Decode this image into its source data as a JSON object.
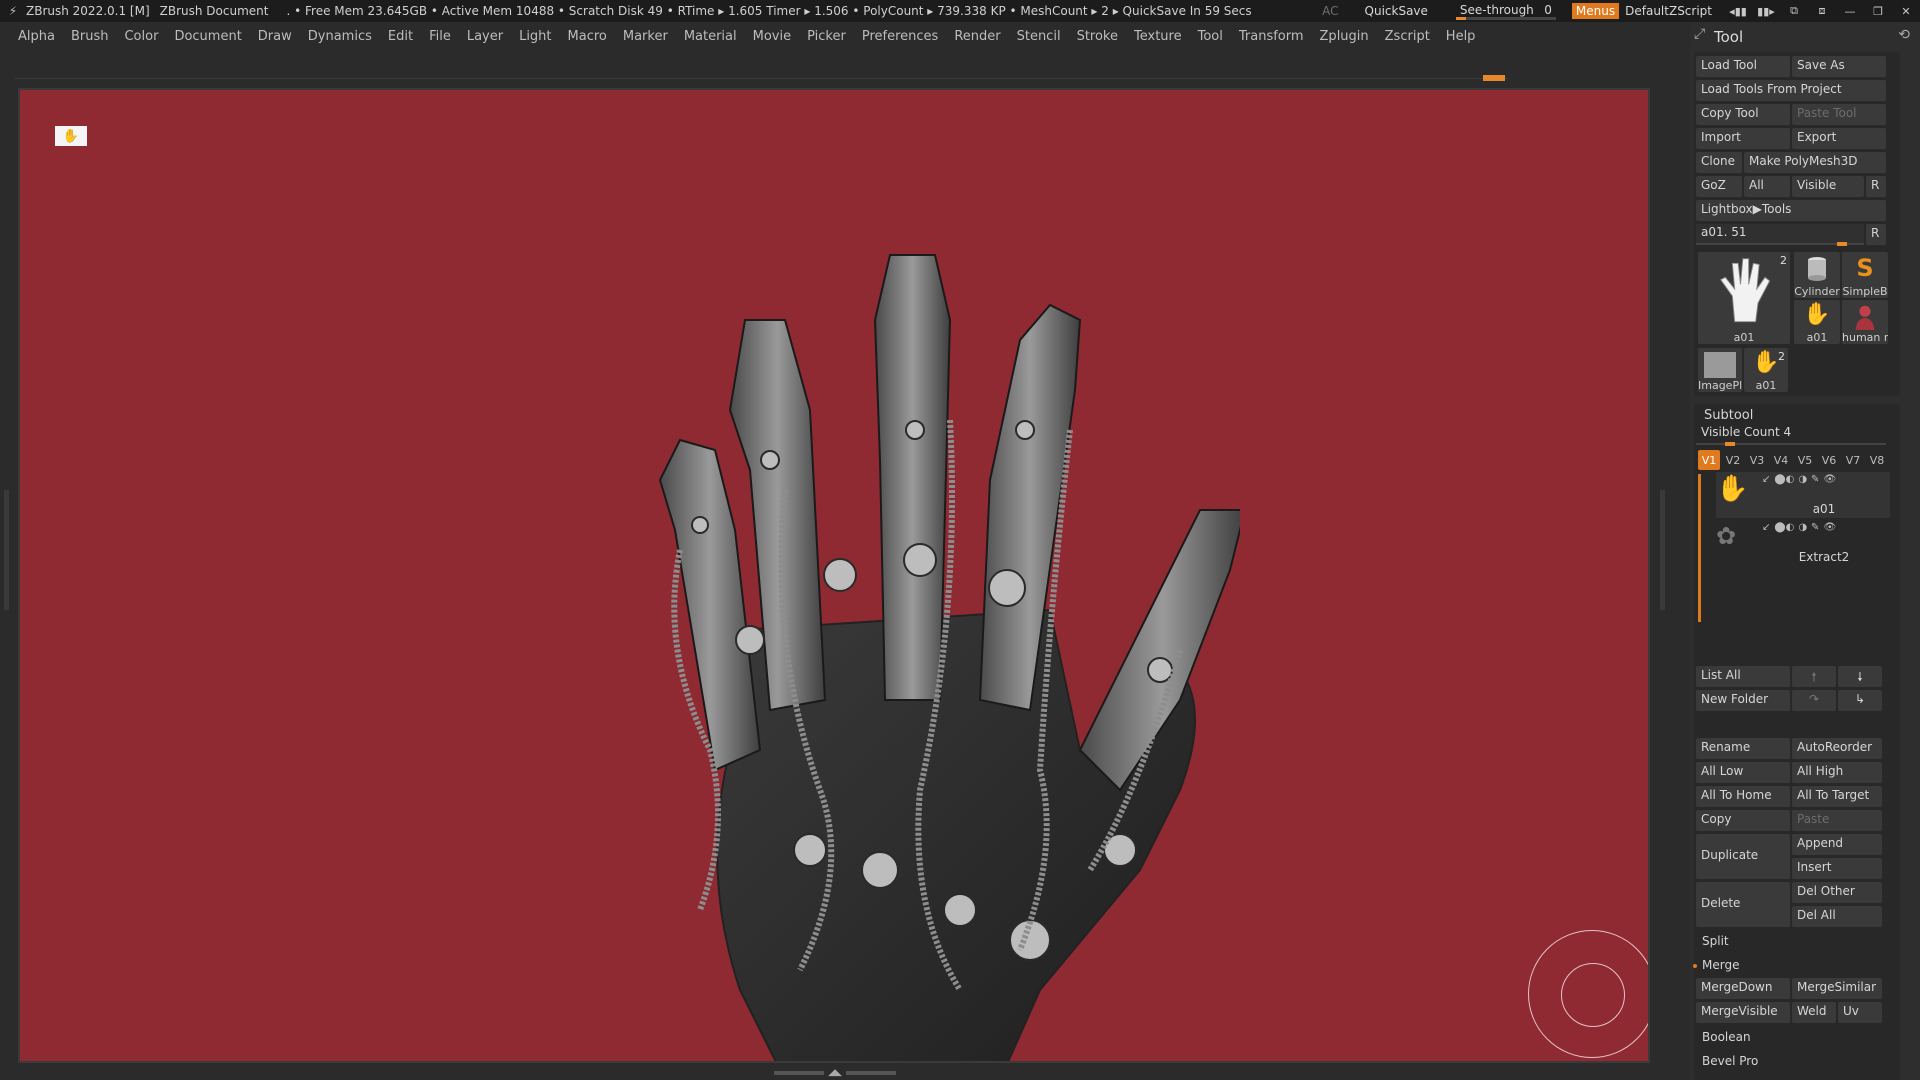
{
  "titlebar": {
    "app_title": "ZBrush 2022.0.1 [M]",
    "document": "ZBrush Document",
    "stats": ". • Free Mem 23.645GB • Active Mem 10488 • Scratch Disk 49 •  RTime ▸ 1.605 Timer ▸ 1.506 • PolyCount ▸ 739.338 KP  • MeshCount ▸ 2  ▸ QuickSave In 59 Secs",
    "ac": "AC",
    "quicksave": "QuickSave",
    "see_through_label": "See-through",
    "see_through_value": "0",
    "see_through_fraction": 0.1,
    "menus": "Menus",
    "default_zscript": "DefaultZScript"
  },
  "menubar": [
    "Alpha",
    "Brush",
    "Color",
    "Document",
    "Draw",
    "Dynamics",
    "Edit",
    "File",
    "Layer",
    "Light",
    "Macro",
    "Marker",
    "Material",
    "Movie",
    "Picker",
    "Preferences",
    "Render",
    "Stencil",
    "Stroke",
    "Texture",
    "Tool",
    "Transform",
    "Zplugin",
    "Zscript",
    "Help"
  ],
  "canvas": {
    "background": "#8f2a33",
    "model_name": "a01"
  },
  "tool_panel": {
    "title": "Tool",
    "load_tool": "Load Tool",
    "save_as": "Save As",
    "load_tools_from_project": "Load Tools From Project",
    "copy_tool": "Copy Tool",
    "paste_tool": "Paste Tool",
    "import": "Import",
    "export": "Export",
    "clone": "Clone",
    "make_polymesh3d": "Make PolyMesh3D",
    "goz": "GoZ",
    "all": "All",
    "visible": "Visible",
    "r": "R",
    "lightbox_tools": "Lightbox▶Tools",
    "current_tool_slider": "a01. 51",
    "current_tool_fraction": 0.9,
    "thumbs": [
      {
        "caption": "a01",
        "count": "2"
      },
      {
        "caption": "Cylinder"
      },
      {
        "caption": "SimpleB"
      },
      {
        "caption": "a01"
      },
      {
        "caption": "human r"
      },
      {
        "caption": "ImagePl"
      },
      {
        "caption": "a01",
        "count": "2"
      }
    ]
  },
  "subtool": {
    "header": "Subtool",
    "visible_count": "Visible Count 4",
    "visible_count_fraction": 0.15,
    "vtabs": [
      "V1",
      "V2",
      "V3",
      "V4",
      "V5",
      "V6",
      "V7",
      "V8"
    ],
    "items": [
      {
        "name": "a01"
      },
      {
        "name": "Extract2"
      }
    ],
    "list_all": "List All",
    "new_folder": "New Folder",
    "rename": "Rename",
    "autoreorder": "AutoReorder",
    "all_low": "All Low",
    "all_high": "All High",
    "all_to_home": "All To Home",
    "all_to_target": "All To Target",
    "copy": "Copy",
    "paste": "Paste",
    "duplicate": "Duplicate",
    "append": "Append",
    "insert": "Insert",
    "delete": "Delete",
    "del_other": "Del Other",
    "del_all": "Del All",
    "split": "Split",
    "merge": "Merge",
    "mergedown": "MergeDown",
    "mergesimilar": "MergeSimilar",
    "mergevisible": "MergeVisible",
    "weld": "Weld",
    "uv": "Uv",
    "boolean": "Boolean",
    "bevel_pro": "Bevel Pro"
  }
}
